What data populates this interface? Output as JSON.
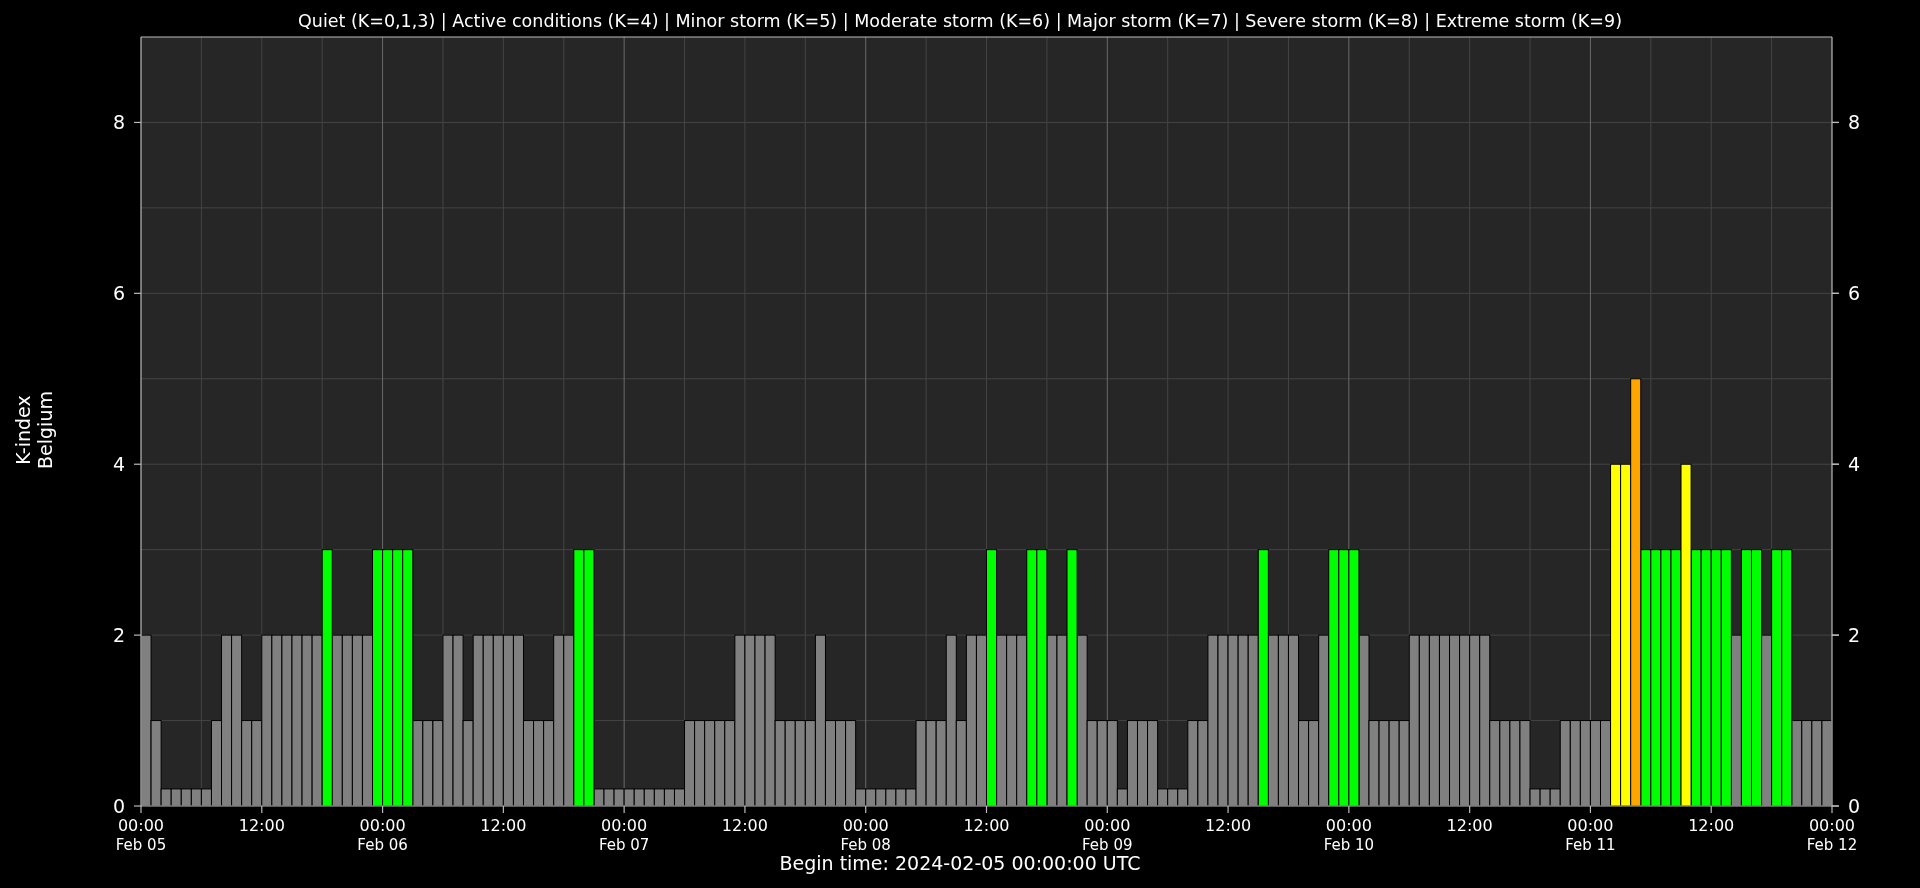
{
  "chart_data": {
    "type": "bar",
    "title": "Quiet (K=0,1,3) | Active conditions (K=4) | Minor storm (K=5) | Moderate storm (K=6) | Major storm (K=7) | Severe storm (K=8) | Extreme storm (K=9)",
    "xlabel": "Begin time: 2024-02-05 00:00:00 UTC",
    "ylabel": "K-index\nBelgium",
    "ylim": [
      0,
      9
    ],
    "grid": true,
    "categories": [
      "00:00\nFeb 05",
      null,
      null,
      null,
      null,
      null,
      null,
      null,
      null,
      null,
      null,
      null,
      "12:00",
      null,
      null,
      null,
      null,
      null,
      null,
      null,
      null,
      null,
      null,
      null,
      "00:00\nFeb 06",
      null,
      null,
      null,
      null,
      null,
      null,
      null,
      null,
      null,
      null,
      null,
      "12:00",
      null,
      null,
      null,
      null,
      null,
      null,
      null,
      null,
      null,
      null,
      null,
      "00:00\nFeb 07",
      null,
      null,
      null,
      null,
      null,
      null,
      null,
      null,
      null,
      null,
      null,
      "12:00",
      null,
      null,
      null,
      null,
      null,
      null,
      null,
      null,
      null,
      null,
      null,
      "00:00\nFeb 08",
      null,
      null,
      null,
      null,
      null,
      null,
      null,
      null,
      null,
      null,
      null,
      "12:00",
      null,
      null,
      null,
      null,
      null,
      null,
      null,
      null,
      null,
      null,
      null,
      "00:00\nFeb 09",
      null,
      null,
      null,
      null,
      null,
      null,
      null,
      null,
      null,
      null,
      null,
      "12:00",
      null,
      null,
      null,
      null,
      null,
      null,
      null,
      null,
      null,
      null,
      null,
      "00:00\nFeb 10",
      null,
      null,
      null,
      null,
      null,
      null,
      null,
      null,
      null,
      null,
      null,
      "12:00",
      null,
      null,
      null,
      null,
      null,
      null,
      null,
      null,
      null,
      null,
      null,
      "00:00\nFeb 11",
      null,
      null,
      null,
      null,
      null,
      null,
      null,
      null,
      null,
      null,
      null,
      "12:00",
      null,
      null,
      null,
      null,
      null,
      null,
      null,
      null,
      null,
      null,
      null,
      "00:00\nFeb 12"
    ],
    "yticks": [
      0,
      2,
      4,
      6,
      8
    ],
    "y2ticks": [
      0,
      2,
      4,
      6,
      8
    ],
    "y2lim": [
      0,
      9
    ],
    "series": [
      {
        "color": "#808080",
        "values": [
          2,
          1,
          0.2,
          0.2,
          0.2,
          0.2,
          0.2,
          1,
          2,
          2,
          1,
          1,
          2,
          2,
          2,
          2,
          2,
          2,
          null,
          2,
          2,
          2,
          2,
          null,
          null,
          null,
          null,
          1,
          1,
          1,
          2,
          2,
          1,
          2,
          2,
          2,
          2,
          2,
          1,
          1,
          1,
          2,
          2,
          null,
          null,
          0.2,
          0.2,
          0.2,
          0.2,
          0.2,
          0.2,
          0.2,
          0.2,
          0.2,
          1,
          1,
          1,
          1,
          1,
          2,
          2,
          2,
          2,
          1,
          1,
          1,
          1,
          2,
          1,
          1,
          1,
          0.2,
          0.2,
          0.2,
          0.2,
          0.2,
          0.2,
          1,
          1,
          1,
          2,
          1,
          2,
          2,
          null,
          2,
          2,
          2,
          null,
          null,
          2,
          2,
          null,
          2,
          1,
          1,
          1,
          0.2,
          1,
          1,
          1,
          0.2,
          0.2,
          0.2,
          1,
          1,
          2,
          2,
          2,
          2,
          2,
          null,
          2,
          2,
          2,
          1,
          1,
          2,
          null,
          null,
          null,
          2,
          1,
          1,
          1,
          1,
          2,
          2,
          2,
          2,
          2,
          2,
          2,
          2,
          1,
          1,
          1,
          1,
          0.2,
          0.2,
          0.2,
          1,
          1,
          1,
          1,
          1,
          null,
          null,
          null,
          null,
          null,
          null,
          null,
          null,
          null,
          null,
          null,
          null,
          2,
          null,
          null,
          2,
          null,
          null,
          1,
          1,
          1,
          1,
          null
        ]
      },
      {
        "color": "#00ff00",
        "values": [
          null,
          null,
          null,
          null,
          null,
          null,
          null,
          null,
          null,
          null,
          null,
          null,
          null,
          null,
          null,
          null,
          null,
          null,
          3,
          null,
          null,
          null,
          null,
          3,
          3,
          3,
          3,
          null,
          null,
          null,
          null,
          null,
          null,
          null,
          null,
          null,
          null,
          null,
          null,
          null,
          null,
          null,
          null,
          3,
          3,
          null,
          null,
          null,
          null,
          null,
          null,
          null,
          null,
          null,
          null,
          null,
          null,
          null,
          null,
          null,
          null,
          null,
          null,
          null,
          null,
          null,
          null,
          null,
          null,
          null,
          null,
          null,
          null,
          null,
          null,
          null,
          null,
          null,
          null,
          null,
          null,
          null,
          null,
          null,
          3,
          null,
          null,
          null,
          3,
          3,
          null,
          null,
          3,
          null,
          null,
          null,
          null,
          null,
          null,
          null,
          null,
          null,
          null,
          null,
          null,
          null,
          null,
          null,
          null,
          null,
          null,
          3,
          null,
          null,
          null,
          null,
          null,
          null,
          3,
          3,
          3,
          null,
          null,
          null,
          null,
          null,
          null,
          null,
          null,
          null,
          null,
          null,
          null,
          null,
          null,
          null,
          null,
          null,
          null,
          null,
          null,
          null,
          null,
          null,
          null,
          null,
          null,
          null,
          null,
          3,
          3,
          3,
          3,
          null,
          3,
          3,
          3,
          3,
          null,
          3,
          3,
          null,
          3,
          3,
          null,
          null,
          null,
          null,
          null
        ]
      },
      {
        "color": "#ffff00",
        "values": [
          null,
          null,
          null,
          null,
          null,
          null,
          null,
          null,
          null,
          null,
          null,
          null,
          null,
          null,
          null,
          null,
          null,
          null,
          null,
          null,
          null,
          null,
          null,
          null,
          null,
          null,
          null,
          null,
          null,
          null,
          null,
          null,
          null,
          null,
          null,
          null,
          null,
          null,
          null,
          null,
          null,
          null,
          null,
          null,
          null,
          null,
          null,
          null,
          null,
          null,
          null,
          null,
          null,
          null,
          null,
          null,
          null,
          null,
          null,
          null,
          null,
          null,
          null,
          null,
          null,
          null,
          null,
          null,
          null,
          null,
          null,
          null,
          null,
          null,
          null,
          null,
          null,
          null,
          null,
          null,
          null,
          null,
          null,
          null,
          null,
          null,
          null,
          null,
          null,
          null,
          null,
          null,
          null,
          null,
          null,
          null,
          null,
          null,
          null,
          null,
          null,
          null,
          null,
          null,
          null,
          null,
          null,
          null,
          null,
          null,
          null,
          null,
          null,
          null,
          null,
          null,
          null,
          null,
          null,
          null,
          null,
          null,
          null,
          null,
          null,
          null,
          null,
          null,
          null,
          null,
          null,
          null,
          null,
          null,
          null,
          null,
          null,
          null,
          null,
          null,
          null,
          null,
          null,
          null,
          null,
          null,
          4,
          4,
          null,
          null,
          null,
          null,
          null,
          4,
          null,
          null,
          null,
          null,
          null,
          null,
          null,
          null,
          null,
          null,
          null,
          null,
          null,
          null,
          null
        ]
      },
      {
        "color": "#ffa500",
        "values": [
          null,
          null,
          null,
          null,
          null,
          null,
          null,
          null,
          null,
          null,
          null,
          null,
          null,
          null,
          null,
          null,
          null,
          null,
          null,
          null,
          null,
          null,
          null,
          null,
          null,
          null,
          null,
          null,
          null,
          null,
          null,
          null,
          null,
          null,
          null,
          null,
          null,
          null,
          null,
          null,
          null,
          null,
          null,
          null,
          null,
          null,
          null,
          null,
          null,
          null,
          null,
          null,
          null,
          null,
          null,
          null,
          null,
          null,
          null,
          null,
          null,
          null,
          null,
          null,
          null,
          null,
          null,
          null,
          null,
          null,
          null,
          null,
          null,
          null,
          null,
          null,
          null,
          null,
          null,
          null,
          null,
          null,
          null,
          null,
          null,
          null,
          null,
          null,
          null,
          null,
          null,
          null,
          null,
          null,
          null,
          null,
          null,
          null,
          null,
          null,
          null,
          null,
          null,
          null,
          null,
          null,
          null,
          null,
          null,
          null,
          null,
          null,
          null,
          null,
          null,
          null,
          null,
          null,
          null,
          null,
          null,
          null,
          null,
          null,
          null,
          null,
          null,
          null,
          null,
          null,
          null,
          null,
          null,
          null,
          null,
          null,
          null,
          null,
          null,
          null,
          null,
          null,
          null,
          null,
          null,
          null,
          null,
          null,
          5,
          null,
          null,
          null,
          null,
          null,
          null,
          null,
          null,
          null,
          null,
          null,
          null,
          null,
          null,
          null,
          null,
          null,
          null,
          null,
          null
        ]
      }
    ]
  }
}
